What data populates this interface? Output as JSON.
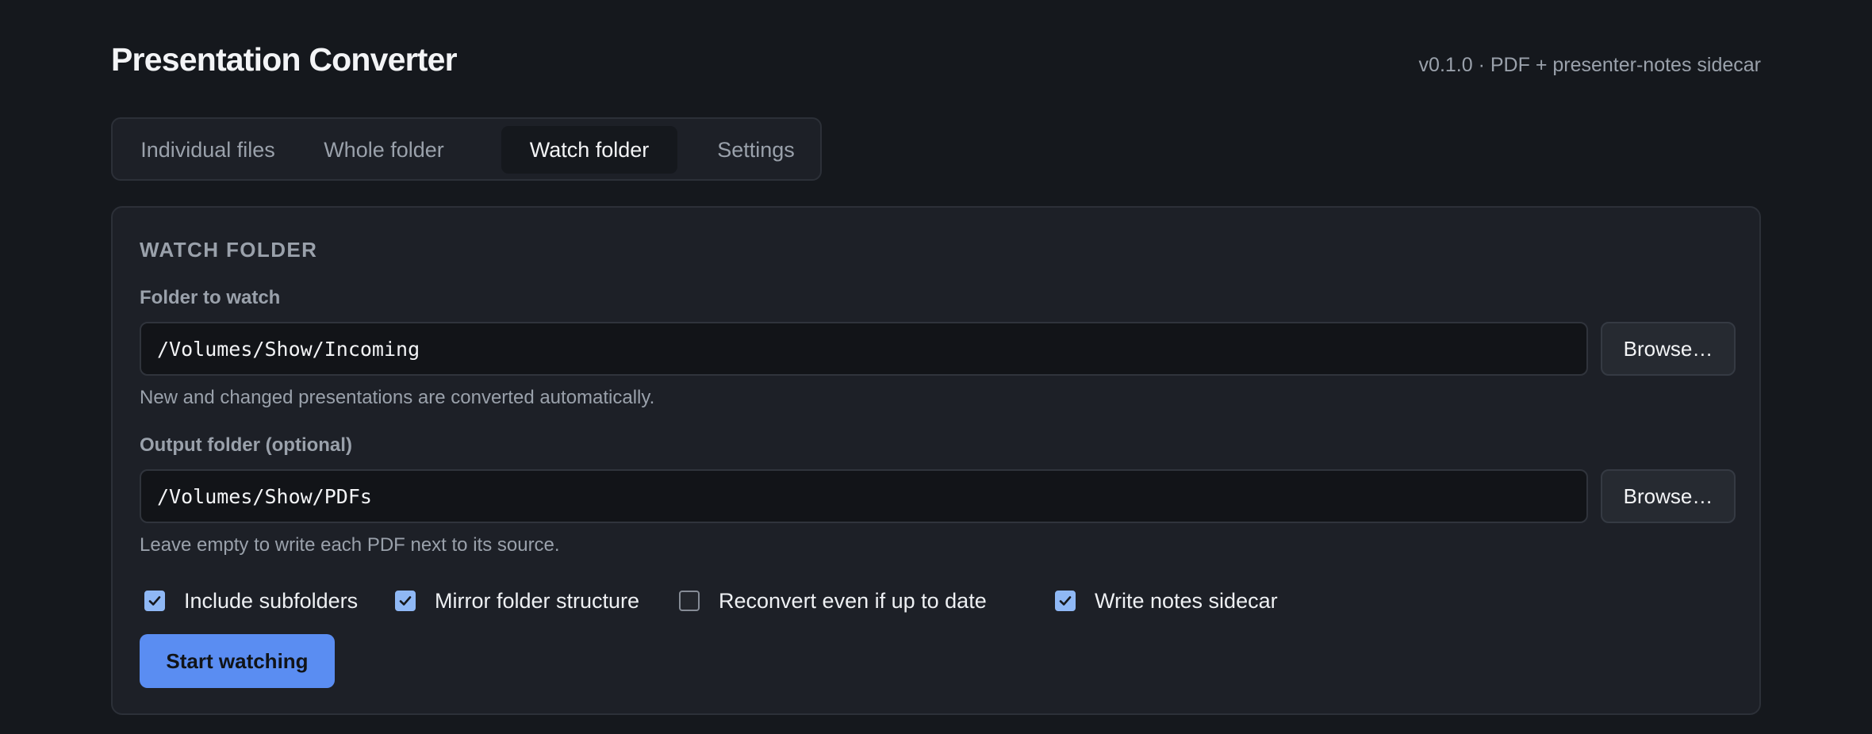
{
  "app": {
    "title": "Presentation Converter",
    "version": "v0.1.0 · PDF + presenter-notes sidecar"
  },
  "tabs": [
    {
      "label": "Individual files",
      "active": false
    },
    {
      "label": "Whole folder",
      "active": false
    },
    {
      "label": "Watch folder",
      "active": true
    },
    {
      "label": "Settings",
      "active": false
    }
  ],
  "watch": {
    "section_title": "WATCH FOLDER",
    "folder_label": "Folder to watch",
    "folder_value": "/Volumes/Show/Incoming",
    "folder_hint": "New and changed presentations are converted automatically.",
    "output_label": "Output folder (optional)",
    "output_value": "/Volumes/Show/PDFs",
    "output_hint": "Leave empty to write each PDF next to its source.",
    "browse_label": "Browse…",
    "options": [
      {
        "label": "Include subfolders",
        "checked": true
      },
      {
        "label": "Mirror folder structure",
        "checked": true
      },
      {
        "label": "Reconvert even if up to date",
        "checked": false
      },
      {
        "label": "Write notes sidecar",
        "checked": true
      }
    ],
    "start_label": "Start watching"
  },
  "colors": {
    "background": "#15181d",
    "panel": "#1d2027",
    "accent": "#5a8df2",
    "checkbox_checked": "#8fb8f5"
  }
}
